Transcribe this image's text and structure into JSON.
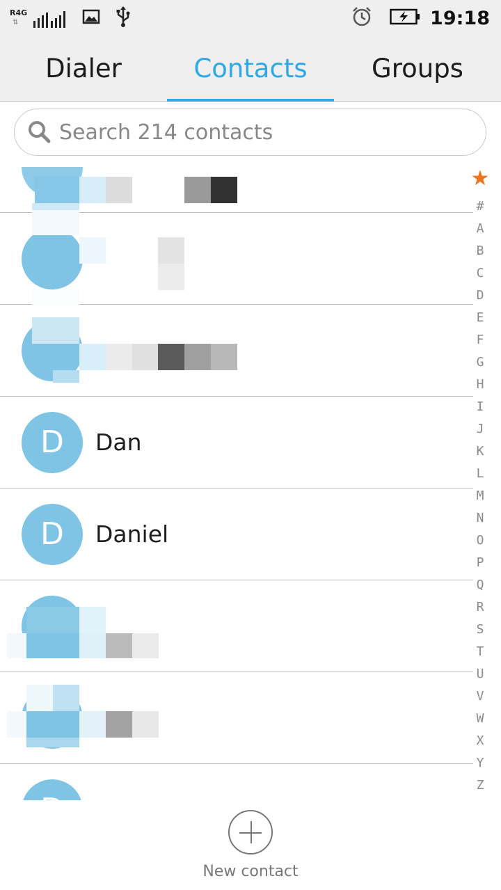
{
  "status_bar": {
    "network_label": "R4G",
    "time": "19:18",
    "icons": [
      "signal-icon",
      "image-icon",
      "usb-icon",
      "alarm-icon",
      "battery-charging-icon"
    ]
  },
  "tabs": [
    {
      "label": "Dialer",
      "active": false
    },
    {
      "label": "Contacts",
      "active": true
    },
    {
      "label": "Groups",
      "active": false
    }
  ],
  "search": {
    "placeholder": "Search 214 contacts"
  },
  "contacts": [
    {
      "initial": "",
      "name": "",
      "obscured": true
    },
    {
      "initial": "",
      "name": "",
      "obscured": true
    },
    {
      "initial": "",
      "name": "",
      "obscured": true
    },
    {
      "initial": "D",
      "name": "Dan",
      "obscured": false
    },
    {
      "initial": "D",
      "name": "Daniel",
      "obscured": false
    },
    {
      "initial": "",
      "name": "",
      "obscured": true
    },
    {
      "initial": "",
      "name": "",
      "obscured": true
    },
    {
      "initial": "D",
      "name": "",
      "obscured": false
    }
  ],
  "index": {
    "star": "★",
    "letters": [
      "#",
      "A",
      "B",
      "C",
      "D",
      "E",
      "F",
      "G",
      "H",
      "I",
      "J",
      "K",
      "L",
      "M",
      "N",
      "O",
      "P",
      "Q",
      "R",
      "S",
      "T",
      "U",
      "V",
      "W",
      "X",
      "Y",
      "Z"
    ]
  },
  "new_contact": {
    "label": "New contact"
  },
  "colors": {
    "accent": "#2fa9e6",
    "avatar": "#7fc4e4",
    "star": "#f0731e"
  }
}
